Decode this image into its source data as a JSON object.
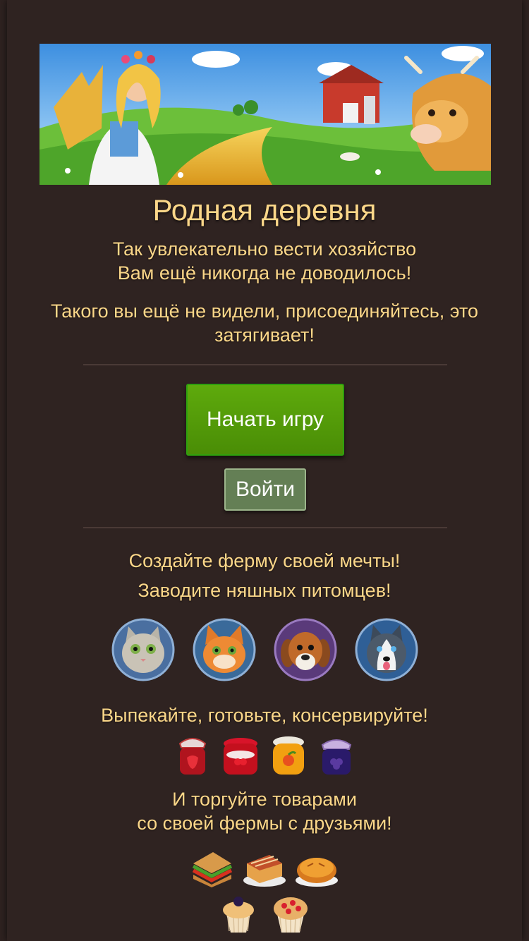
{
  "header": {
    "title": "Родная деревня",
    "tagline_line1": "Так увлекательно вести хозяйство",
    "tagline_line2": "Вам ещё никогда не доводилось!",
    "invite_line1": "Такого вы ещё не видели, присоединяйтесь, это",
    "invite_line2": "затягивает!"
  },
  "actions": {
    "start_label": "Начать игру",
    "login_label": "Войти"
  },
  "features": {
    "farm": "Создайте ферму своей мечты!",
    "pets": "Заводите няшных питомцев!",
    "cooking": "Выпекайте, готовьте, консервируйте!",
    "trade_line1": "И торгуйте товарами",
    "trade_line2": "со своей фермы с друзьями!"
  },
  "pets": [
    "cat-gray-icon",
    "cat-ginger-icon",
    "dog-beagle-icon",
    "dog-husky-icon"
  ],
  "jars": [
    "strawberry-jam-icon",
    "cherry-jam-icon",
    "apricot-jam-icon",
    "blackberry-jam-icon"
  ],
  "foods": [
    "sandwich-icon",
    "cake-slice-icon",
    "pie-icon",
    "blackberry-muffin-icon",
    "raspberry-muffin-icon"
  ],
  "colors": {
    "background": "#2f2321",
    "text": "#fbd789",
    "start_button": "#4f930a",
    "login_button": "#647f55"
  }
}
